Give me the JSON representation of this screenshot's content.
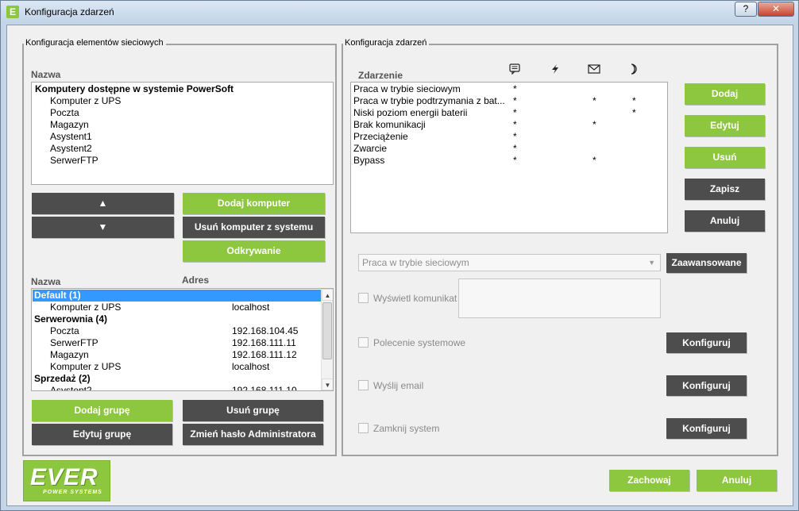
{
  "window": {
    "title": "Konfiguracja zdarzeń",
    "help_label": "?",
    "close_label": "✕"
  },
  "left_panel": {
    "title": "Konfiguracja elementów sieciowych",
    "name_header": "Nazwa",
    "tree": {
      "root": "Komputery dostępne w systemie PowerSoft",
      "children": [
        "Komputer z UPS",
        "Poczta",
        "Magazyn",
        "Asystent1",
        "Asystent2",
        "SerwerFTP"
      ]
    },
    "buttons": {
      "up": "▲",
      "down": "▼",
      "add_computer": "Dodaj komputer",
      "remove_computer": "Usuń komputer z systemu",
      "discover": "Odkrywanie"
    },
    "groups_header_name": "Nazwa",
    "groups_header_address": "Adres",
    "groups": [
      {
        "name": "Default (1)",
        "address": "",
        "bold": true,
        "indent": false
      },
      {
        "name": "Komputer z UPS",
        "address": "localhost",
        "bold": false,
        "indent": true
      },
      {
        "name": "Serwerownia (4)",
        "address": "",
        "bold": true,
        "indent": false
      },
      {
        "name": "Poczta",
        "address": "192.168.104.45",
        "bold": false,
        "indent": true
      },
      {
        "name": "SerwerFTP",
        "address": "192.168.111.11",
        "bold": false,
        "indent": true
      },
      {
        "name": "Magazyn",
        "address": "192.168.111.12",
        "bold": false,
        "indent": true
      },
      {
        "name": "Komputer z UPS",
        "address": "localhost",
        "bold": false,
        "indent": true
      },
      {
        "name": "Sprzedaż (2)",
        "address": "",
        "bold": true,
        "indent": false
      },
      {
        "name": "Asystent2",
        "address": "192.168.111.10",
        "bold": false,
        "indent": true
      }
    ],
    "group_buttons": {
      "add_group": "Dodaj grupę",
      "remove_group": "Usuń grupę",
      "edit_group": "Edytuj grupę",
      "change_password": "Zmień hasło Administratora"
    }
  },
  "right_panel": {
    "title": "Konfiguracja zdarzeń",
    "event_header": "Zdarzenie",
    "icon_names": [
      "message-icon",
      "lightning-icon",
      "envelope-icon",
      "moon-icon"
    ],
    "events": [
      {
        "name": "Praca w trybie sieciowym",
        "message": "*",
        "command": "",
        "email": "",
        "shutdown": ""
      },
      {
        "name": "Praca w trybie podtrzymania z bat...",
        "message": "*",
        "command": "",
        "email": "*",
        "shutdown": "*"
      },
      {
        "name": "Niski poziom energii baterii",
        "message": "*",
        "command": "",
        "email": "",
        "shutdown": "*"
      },
      {
        "name": "Brak komunikacji",
        "message": "*",
        "command": "",
        "email": "*",
        "shutdown": ""
      },
      {
        "name": "Przeciążenie",
        "message": "*",
        "command": "",
        "email": "",
        "shutdown": ""
      },
      {
        "name": "Zwarcie",
        "message": "*",
        "command": "",
        "email": "",
        "shutdown": ""
      },
      {
        "name": "Bypass",
        "message": "*",
        "command": "",
        "email": "*",
        "shutdown": ""
      }
    ],
    "buttons": {
      "add": "Dodaj",
      "edit": "Edytuj",
      "remove": "Usuń",
      "save": "Zapisz",
      "cancel": "Anuluj"
    },
    "event_select": "Praca w trybie sieciowym",
    "advanced": "Zaawansowane",
    "options": {
      "show_message": "Wyświetl komunikat",
      "system_command": "Polecenie systemowe",
      "send_email": "Wyślij email",
      "shutdown_system": "Zamknij system"
    },
    "configure": "Konfiguruj"
  },
  "footer": {
    "logo_main": "EVER",
    "logo_sub": "POWER SYSTEMS",
    "save": "Zachowaj",
    "cancel": "Anuluj"
  },
  "colors": {
    "green": "#8dc63f",
    "dark": "#4d4d4d",
    "selection": "#3399ff"
  }
}
